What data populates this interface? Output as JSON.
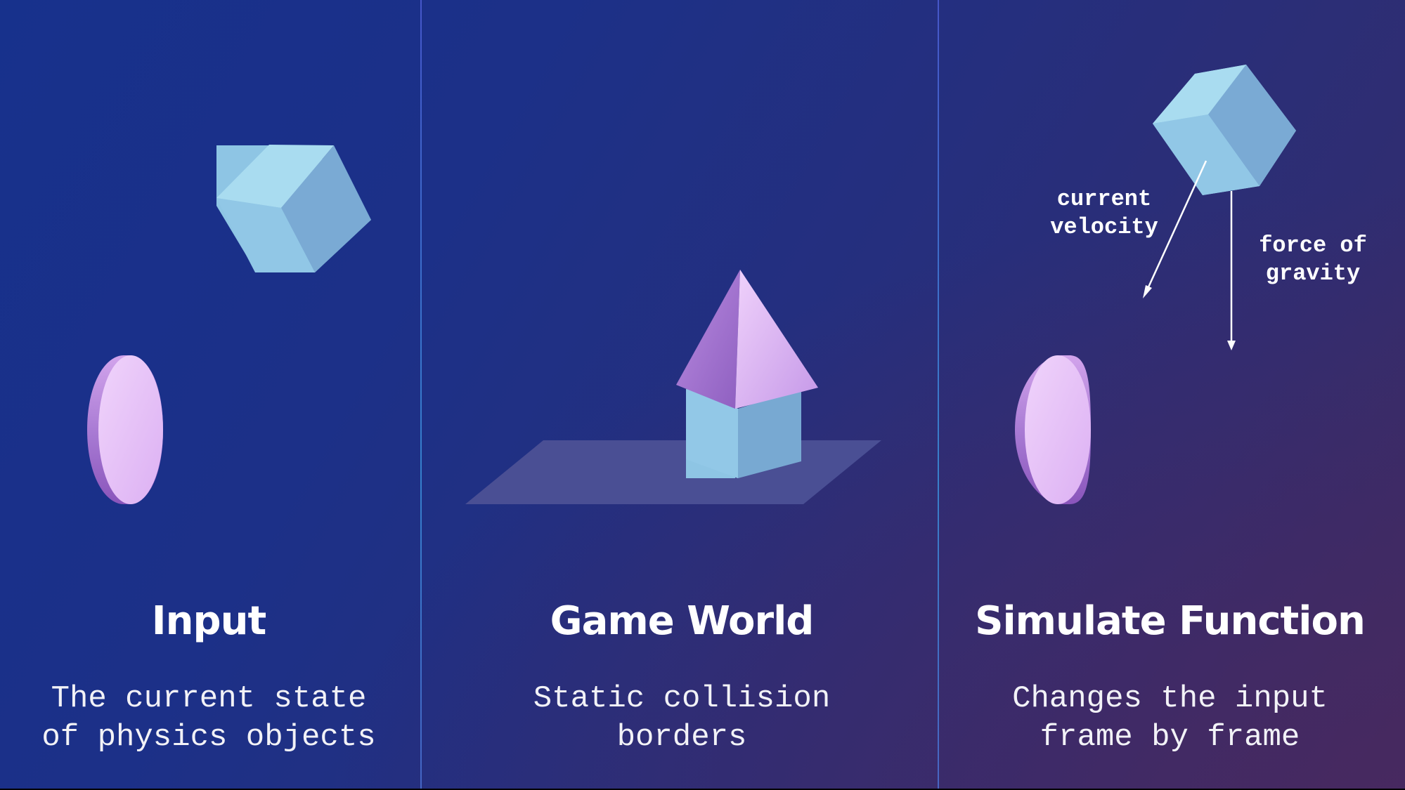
{
  "panels": [
    {
      "title": "Input",
      "description": "The current state\nof physics objects"
    },
    {
      "title": "Game World",
      "description": "Static collision\nborders"
    },
    {
      "title": "Simulate Function",
      "description": "Changes the input\nframe by frame"
    }
  ],
  "annotations": {
    "velocity": "current\nvelocity",
    "gravity": "force of\ngravity"
  },
  "colors": {
    "cube_top": "#a9dcf0",
    "cube_left": "#8ec5e4",
    "cube_right": "#79aad4",
    "disc_face": "#e7c2f7",
    "disc_side": "#9a68c6",
    "pyramid_left": "#9b6ec8",
    "pyramid_right": "#d9aef0",
    "ground_plane": "#4a4f94"
  }
}
